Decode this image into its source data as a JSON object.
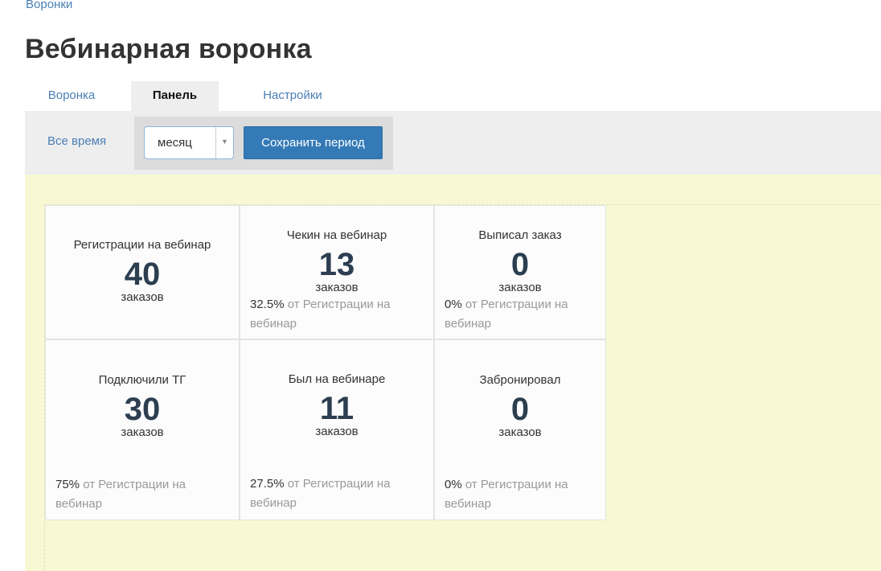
{
  "breadcrumb": "Воронки",
  "page_title": "Вебинарная воронка",
  "tabs": [
    {
      "label": "Воронка",
      "active": false
    },
    {
      "label": "Панель",
      "active": true
    },
    {
      "label": "Настройки",
      "active": false
    }
  ],
  "filter": {
    "all_time_label": "Все время",
    "period_value": "месяц",
    "save_label": "Сохранить период"
  },
  "cards": [
    {
      "title": "Регистрации на вебинар",
      "value": "40",
      "unit": "заказов",
      "pct": "",
      "note": ""
    },
    {
      "title": "Чекин на вебинар",
      "value": "13",
      "unit": "заказов",
      "pct": "32.5%",
      "note": "от Регистрации на вебинар"
    },
    {
      "title": "Выписал заказ",
      "value": "0",
      "unit": "заказов",
      "pct": "0%",
      "note": "от Регистрации на вебинар"
    },
    {
      "title": "Подключили ТГ",
      "value": "30",
      "unit": "заказов",
      "pct": "75%",
      "note": "от Регистрации на вебинар"
    },
    {
      "title": "Был на вебинаре",
      "value": "11",
      "unit": "заказов",
      "pct": "27.5%",
      "note": "от Регистрации на вебинар"
    },
    {
      "title": "Забронировал",
      "value": "0",
      "unit": "заказов",
      "pct": "0%",
      "note": "от Регистрации на вебинар"
    }
  ],
  "colors": {
    "link": "#4a7fb5",
    "primary_button": "#337ab7",
    "dashboard_bg": "#f8f9d4",
    "value_text": "#2c3e50"
  },
  "icons": {
    "select_arrow": "caret-down-icon"
  }
}
